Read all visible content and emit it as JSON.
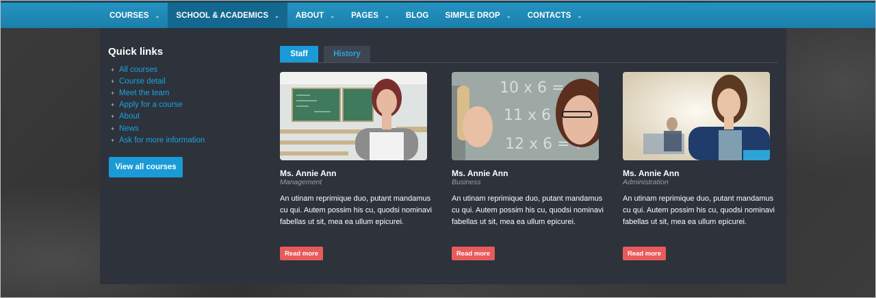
{
  "nav": {
    "items": [
      {
        "label": "COURSES",
        "chevron": true
      },
      {
        "label": "SCHOOL & ACADEMICS",
        "chevron": true
      },
      {
        "label": "ABOUT",
        "chevron": true
      },
      {
        "label": "PAGES",
        "chevron": true
      },
      {
        "label": "BLOG",
        "chevron": false
      },
      {
        "label": "SIMPLE DROP",
        "chevron": true
      },
      {
        "label": "CONTACTS",
        "chevron": true
      }
    ],
    "chevron_glyph": "⌄",
    "active_color": "#14688f"
  },
  "quick_links": {
    "title": "Quick links",
    "bullet": "+",
    "items": [
      "All courses",
      "Course detail",
      "Meet the team",
      "Apply for a course",
      "About",
      "News",
      "Ask for more information"
    ],
    "view_all_label": "View all courses"
  },
  "tabs": [
    {
      "label": "Staff",
      "active": true
    },
    {
      "label": "History",
      "active": false
    }
  ],
  "staff": [
    {
      "name": "Ms. Annie Ann",
      "role": "Management",
      "description": "An utinam reprimique duo, putant mandamus cu qui. Autem possim his cu, quodsi nominavi fabellas ut sit, mea ea ullum epicurei.",
      "button": "Read more",
      "image": "teacher-in-classroom"
    },
    {
      "name": "Ms. Annie Ann",
      "role": "Business",
      "description": "An utinam reprimique duo, putant mandamus cu qui. Autem possim his cu, quodsi nominavi fabellas ut sit, mea ea ullum epicurei.",
      "button": "Read more",
      "image": "teacher-at-chalkboard"
    },
    {
      "name": "Ms. Annie Ann",
      "role": "Administration",
      "description": "An utinam reprimique duo, putant mandamus cu qui. Autem possim his cu, quodsi nominavi fabellas ut sit, mea ea ullum epicurei.",
      "button": "Read more",
      "image": "teacher-in-office"
    }
  ],
  "colors": {
    "nav_blue": "#1b88b8",
    "panel_bg": "#2d323b",
    "link_blue": "#1ba3de",
    "button_blue": "#1a9ad6",
    "read_more_red": "#e95a5a"
  }
}
